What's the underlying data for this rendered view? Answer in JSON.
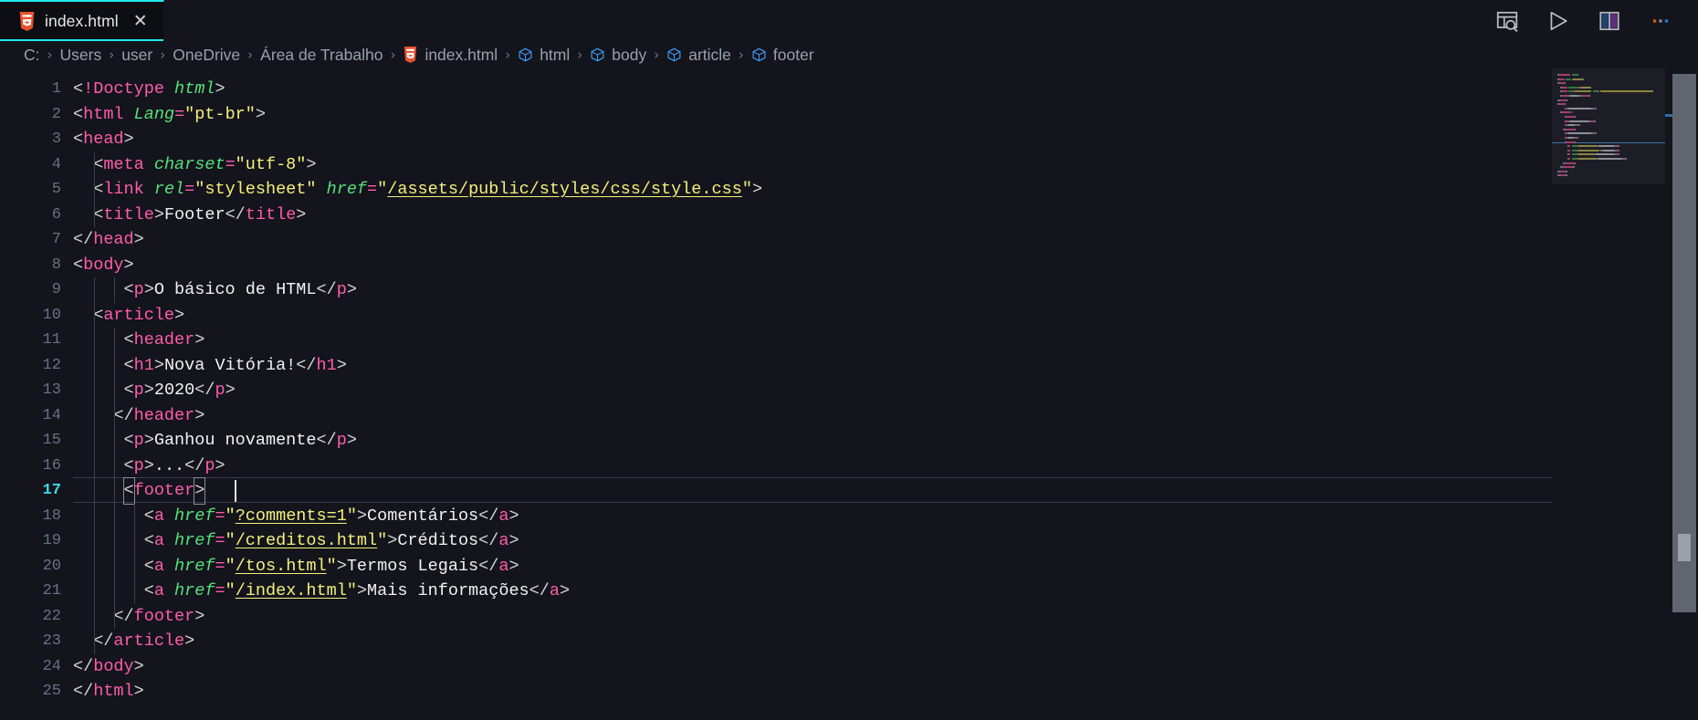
{
  "window": {
    "background": "#13141c",
    "accent": "#1eeaea"
  },
  "tabbar": {
    "tabs": [
      {
        "label": "index.html",
        "icon": "html5-file-icon",
        "close_label": "✕",
        "active": true
      }
    ],
    "actions": [
      {
        "name": "open-preview-icon",
        "title": "Open Preview"
      },
      {
        "name": "run-icon",
        "title": "Run"
      },
      {
        "name": "split-editor-icon",
        "title": "Split Editor"
      },
      {
        "name": "more-actions-icon",
        "title": "More Actions...",
        "glyph": "…"
      }
    ]
  },
  "breadcrumb": {
    "separator": "›",
    "items": [
      {
        "label": "C:",
        "icon": ""
      },
      {
        "label": "Users",
        "icon": ""
      },
      {
        "label": "user",
        "icon": ""
      },
      {
        "label": "OneDrive",
        "icon": ""
      },
      {
        "label": "Área de Trabalho",
        "icon": ""
      },
      {
        "label": "index.html",
        "icon": "html5-file-icon"
      },
      {
        "label": "html",
        "icon": "symbol-field-icon"
      },
      {
        "label": "body",
        "icon": "symbol-field-icon"
      },
      {
        "label": "article",
        "icon": "symbol-field-icon"
      },
      {
        "label": "footer",
        "icon": "symbol-field-icon"
      }
    ]
  },
  "editor": {
    "language": "html",
    "active_line": 17,
    "cursor": {
      "line": 17,
      "column": 16
    },
    "total_lines": 25,
    "colors": {
      "tag": "#ff5caa",
      "attribute": "#55e07a",
      "string": "#f6f07a",
      "text": "#f2f2f2",
      "punctuation": "#d4d4d4",
      "line_number": "#6b7280",
      "line_number_active": "#3fd8e8"
    },
    "lines": [
      {
        "n": 1,
        "indent": 0,
        "tokens": [
          {
            "c": "punc",
            "t": "<"
          },
          {
            "c": "doct",
            "t": "!Doctype"
          },
          {
            "c": "punc",
            "t": " "
          },
          {
            "c": "dhtml",
            "t": "html"
          },
          {
            "c": "punc",
            "t": ">"
          }
        ]
      },
      {
        "n": 2,
        "indent": 0,
        "tokens": [
          {
            "c": "punc",
            "t": "<"
          },
          {
            "c": "tag",
            "t": "html"
          },
          {
            "c": "punc",
            "t": " "
          },
          {
            "c": "attr",
            "t": "Lang"
          },
          {
            "c": "eq",
            "t": "="
          },
          {
            "c": "str",
            "t": "\"pt-br\""
          },
          {
            "c": "punc",
            "t": ">"
          }
        ]
      },
      {
        "n": 3,
        "indent": 0,
        "tokens": [
          {
            "c": "punc",
            "t": "<"
          },
          {
            "c": "tag",
            "t": "head"
          },
          {
            "c": "punc",
            "t": ">"
          }
        ]
      },
      {
        "n": 4,
        "indent": 1,
        "tokens": [
          {
            "c": "punc",
            "t": "  <"
          },
          {
            "c": "tag",
            "t": "meta"
          },
          {
            "c": "punc",
            "t": " "
          },
          {
            "c": "attr",
            "t": "charset"
          },
          {
            "c": "eq",
            "t": "="
          },
          {
            "c": "str",
            "t": "\"utf-8\""
          },
          {
            "c": "punc",
            "t": ">"
          }
        ]
      },
      {
        "n": 5,
        "indent": 1,
        "tokens": [
          {
            "c": "punc",
            "t": "  <"
          },
          {
            "c": "tag",
            "t": "link"
          },
          {
            "c": "punc",
            "t": " "
          },
          {
            "c": "attr",
            "t": "rel"
          },
          {
            "c": "eq",
            "t": "="
          },
          {
            "c": "str",
            "t": "\"stylesheet\""
          },
          {
            "c": "punc",
            "t": " "
          },
          {
            "c": "attr",
            "t": "href"
          },
          {
            "c": "eq",
            "t": "="
          },
          {
            "c": "str",
            "t": "\""
          },
          {
            "c": "link",
            "t": "/assets/public/styles/css/style.css"
          },
          {
            "c": "str",
            "t": "\""
          },
          {
            "c": "punc",
            "t": ">"
          }
        ]
      },
      {
        "n": 6,
        "indent": 1,
        "tokens": [
          {
            "c": "punc",
            "t": "  <"
          },
          {
            "c": "tag",
            "t": "title"
          },
          {
            "c": "punc",
            "t": ">"
          },
          {
            "c": "text",
            "t": "Footer"
          },
          {
            "c": "punc",
            "t": "</"
          },
          {
            "c": "tag",
            "t": "title"
          },
          {
            "c": "punc",
            "t": ">"
          }
        ]
      },
      {
        "n": 7,
        "indent": 0,
        "tokens": [
          {
            "c": "punc",
            "t": "</"
          },
          {
            "c": "tag",
            "t": "head"
          },
          {
            "c": "punc",
            "t": ">"
          }
        ]
      },
      {
        "n": 8,
        "indent": 0,
        "tokens": [
          {
            "c": "punc",
            "t": "<"
          },
          {
            "c": "tag",
            "t": "body"
          },
          {
            "c": "punc",
            "t": ">"
          }
        ]
      },
      {
        "n": 9,
        "indent": 2,
        "tokens": [
          {
            "c": "punc",
            "t": "     <"
          },
          {
            "c": "tag",
            "t": "p"
          },
          {
            "c": "punc",
            "t": ">"
          },
          {
            "c": "text",
            "t": "O básico de HTML"
          },
          {
            "c": "punc",
            "t": "</"
          },
          {
            "c": "tag",
            "t": "p"
          },
          {
            "c": "punc",
            "t": ">"
          }
        ]
      },
      {
        "n": 10,
        "indent": 1,
        "tokens": [
          {
            "c": "punc",
            "t": "  <"
          },
          {
            "c": "tag",
            "t": "article"
          },
          {
            "c": "punc",
            "t": ">"
          }
        ]
      },
      {
        "n": 11,
        "indent": 2,
        "tokens": [
          {
            "c": "punc",
            "t": "     <"
          },
          {
            "c": "tag",
            "t": "header"
          },
          {
            "c": "punc",
            "t": ">"
          }
        ]
      },
      {
        "n": 12,
        "indent": 2,
        "tokens": [
          {
            "c": "punc",
            "t": "     <"
          },
          {
            "c": "tag",
            "t": "h1"
          },
          {
            "c": "punc",
            "t": ">"
          },
          {
            "c": "text",
            "t": "Nova Vitória!"
          },
          {
            "c": "punc",
            "t": "</"
          },
          {
            "c": "tag",
            "t": "h1"
          },
          {
            "c": "punc",
            "t": ">"
          }
        ]
      },
      {
        "n": 13,
        "indent": 2,
        "tokens": [
          {
            "c": "punc",
            "t": "     <"
          },
          {
            "c": "tag",
            "t": "p"
          },
          {
            "c": "punc",
            "t": ">"
          },
          {
            "c": "text",
            "t": "2020"
          },
          {
            "c": "punc",
            "t": "</"
          },
          {
            "c": "tag",
            "t": "p"
          },
          {
            "c": "punc",
            "t": ">"
          }
        ]
      },
      {
        "n": 14,
        "indent": 2,
        "tokens": [
          {
            "c": "punc",
            "t": "    </"
          },
          {
            "c": "tag",
            "t": "header"
          },
          {
            "c": "punc",
            "t": ">"
          }
        ]
      },
      {
        "n": 15,
        "indent": 2,
        "tokens": [
          {
            "c": "punc",
            "t": "     <"
          },
          {
            "c": "tag",
            "t": "p"
          },
          {
            "c": "punc",
            "t": ">"
          },
          {
            "c": "text",
            "t": "Ganhou novamente"
          },
          {
            "c": "punc",
            "t": "</"
          },
          {
            "c": "tag",
            "t": "p"
          },
          {
            "c": "punc",
            "t": ">"
          }
        ]
      },
      {
        "n": 16,
        "indent": 2,
        "tokens": [
          {
            "c": "punc",
            "t": "     <"
          },
          {
            "c": "tag",
            "t": "p"
          },
          {
            "c": "punc",
            "t": ">"
          },
          {
            "c": "text",
            "t": "..."
          },
          {
            "c": "punc",
            "t": "</"
          },
          {
            "c": "tag",
            "t": "p"
          },
          {
            "c": "punc",
            "t": ">"
          }
        ]
      },
      {
        "n": 17,
        "indent": 2,
        "tokens": [
          {
            "c": "punc",
            "t": "     "
          },
          {
            "c": "punc brk",
            "t": "<"
          },
          {
            "c": "tag",
            "t": "footer"
          },
          {
            "c": "punc brk",
            "t": ">"
          }
        ]
      },
      {
        "n": 18,
        "indent": 3,
        "tokens": [
          {
            "c": "punc",
            "t": "       <"
          },
          {
            "c": "tag",
            "t": "a"
          },
          {
            "c": "punc",
            "t": " "
          },
          {
            "c": "attr",
            "t": "href"
          },
          {
            "c": "eq",
            "t": "="
          },
          {
            "c": "str",
            "t": "\""
          },
          {
            "c": "link",
            "t": "?comments=1"
          },
          {
            "c": "str",
            "t": "\""
          },
          {
            "c": "punc",
            "t": ">"
          },
          {
            "c": "text",
            "t": "Comentários"
          },
          {
            "c": "punc",
            "t": "</"
          },
          {
            "c": "tag",
            "t": "a"
          },
          {
            "c": "punc",
            "t": ">"
          }
        ]
      },
      {
        "n": 19,
        "indent": 3,
        "tokens": [
          {
            "c": "punc",
            "t": "       <"
          },
          {
            "c": "tag",
            "t": "a"
          },
          {
            "c": "punc",
            "t": " "
          },
          {
            "c": "attr",
            "t": "href"
          },
          {
            "c": "eq",
            "t": "="
          },
          {
            "c": "str",
            "t": "\""
          },
          {
            "c": "link",
            "t": "/creditos.html"
          },
          {
            "c": "str",
            "t": "\""
          },
          {
            "c": "punc",
            "t": ">"
          },
          {
            "c": "text",
            "t": "Créditos"
          },
          {
            "c": "punc",
            "t": "</"
          },
          {
            "c": "tag",
            "t": "a"
          },
          {
            "c": "punc",
            "t": ">"
          }
        ]
      },
      {
        "n": 20,
        "indent": 3,
        "tokens": [
          {
            "c": "punc",
            "t": "       <"
          },
          {
            "c": "tag",
            "t": "a"
          },
          {
            "c": "punc",
            "t": " "
          },
          {
            "c": "attr",
            "t": "href"
          },
          {
            "c": "eq",
            "t": "="
          },
          {
            "c": "str",
            "t": "\""
          },
          {
            "c": "link",
            "t": "/tos.html"
          },
          {
            "c": "str",
            "t": "\""
          },
          {
            "c": "punc",
            "t": ">"
          },
          {
            "c": "text",
            "t": "Termos Legais"
          },
          {
            "c": "punc",
            "t": "</"
          },
          {
            "c": "tag",
            "t": "a"
          },
          {
            "c": "punc",
            "t": ">"
          }
        ]
      },
      {
        "n": 21,
        "indent": 3,
        "tokens": [
          {
            "c": "punc",
            "t": "       <"
          },
          {
            "c": "tag",
            "t": "a"
          },
          {
            "c": "punc",
            "t": " "
          },
          {
            "c": "attr",
            "t": "href"
          },
          {
            "c": "eq",
            "t": "="
          },
          {
            "c": "str",
            "t": "\""
          },
          {
            "c": "link",
            "t": "/index.html"
          },
          {
            "c": "str",
            "t": "\""
          },
          {
            "c": "punc",
            "t": ">"
          },
          {
            "c": "text",
            "t": "Mais informações"
          },
          {
            "c": "punc",
            "t": "</"
          },
          {
            "c": "tag",
            "t": "a"
          },
          {
            "c": "punc",
            "t": ">"
          }
        ]
      },
      {
        "n": 22,
        "indent": 2,
        "tokens": [
          {
            "c": "punc",
            "t": "    </"
          },
          {
            "c": "tag",
            "t": "footer"
          },
          {
            "c": "punc",
            "t": ">"
          }
        ]
      },
      {
        "n": 23,
        "indent": 1,
        "tokens": [
          {
            "c": "punc",
            "t": "  </"
          },
          {
            "c": "tag",
            "t": "article"
          },
          {
            "c": "punc",
            "t": ">"
          }
        ]
      },
      {
        "n": 24,
        "indent": 0,
        "tokens": [
          {
            "c": "punc",
            "t": "</"
          },
          {
            "c": "tag",
            "t": "body"
          },
          {
            "c": "punc",
            "t": ">"
          }
        ]
      },
      {
        "n": 25,
        "indent": 0,
        "tokens": [
          {
            "c": "punc",
            "t": "</"
          },
          {
            "c": "tag",
            "t": "html"
          },
          {
            "c": "punc",
            "t": ">"
          }
        ]
      }
    ]
  },
  "minimap": {
    "visible": true,
    "current_line_marker": true
  },
  "scrollbar": {
    "visible": true
  }
}
